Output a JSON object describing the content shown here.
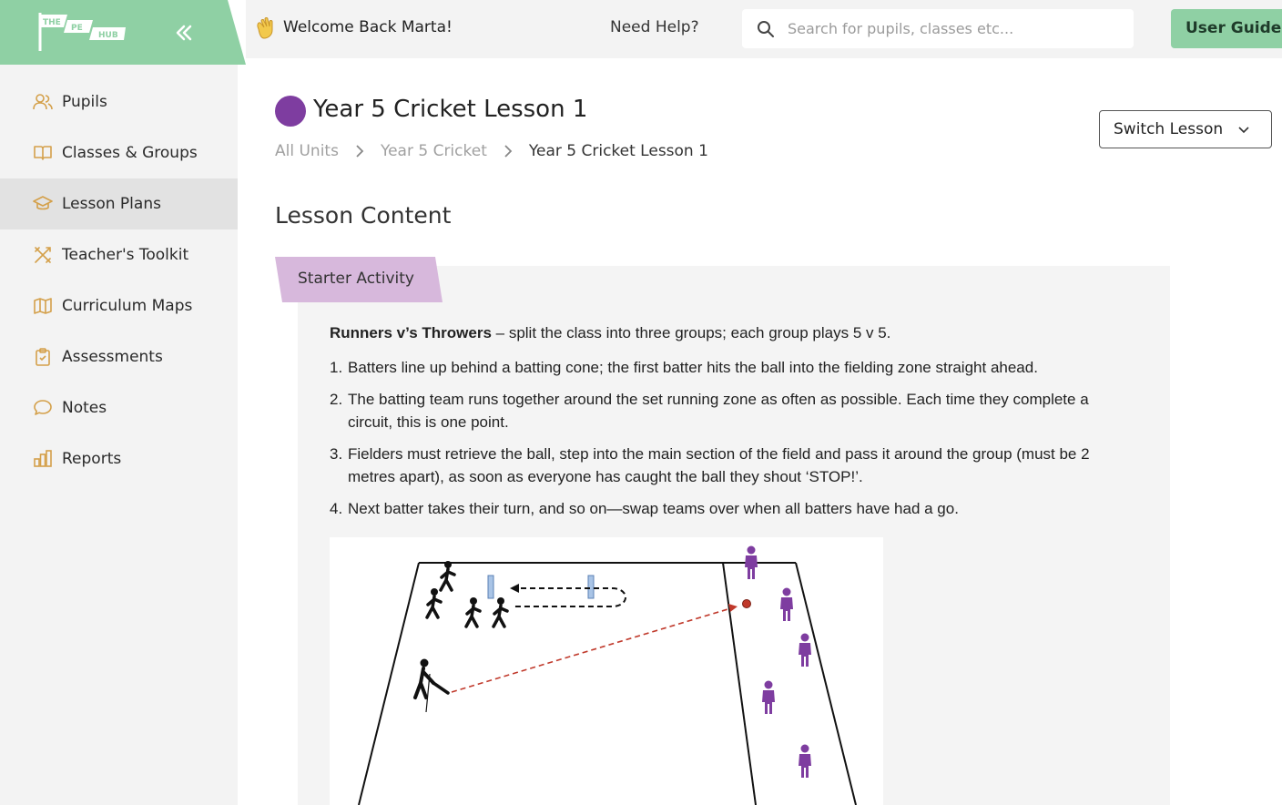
{
  "brand": {
    "logo_words": [
      "THE",
      "PE",
      "HUB"
    ],
    "accent": "#8fd0a4"
  },
  "header": {
    "welcome": "Welcome Back Marta!",
    "need_help": "Need Help?",
    "search_placeholder": "Search for pupils, classes etc...",
    "user_guides": "User Guides"
  },
  "sidebar": {
    "items": [
      {
        "label": "Pupils",
        "icon": "users-icon"
      },
      {
        "label": "Classes & Groups",
        "icon": "book-icon"
      },
      {
        "label": "Lesson Plans",
        "icon": "graduation-cap-icon",
        "active": true
      },
      {
        "label": "Teacher's Toolkit",
        "icon": "tools-icon"
      },
      {
        "label": "Curriculum Maps",
        "icon": "map-icon"
      },
      {
        "label": "Assessments",
        "icon": "clipboard-icon"
      },
      {
        "label": "Notes",
        "icon": "speech-bubble-icon"
      },
      {
        "label": "Reports",
        "icon": "bar-chart-icon"
      }
    ]
  },
  "page": {
    "title": "Year 5 Cricket Lesson 1",
    "title_dot_color": "#7e3da0",
    "breadcrumb": [
      "All Units",
      "Year 5 Cricket",
      "Year 5 Cricket Lesson 1"
    ],
    "switch_lesson": "Switch Lesson",
    "section_title": "Lesson Content"
  },
  "activity": {
    "tab": "Starter Activity",
    "intro_bold": "Runners v’s Throwers",
    "intro_rest": " – split the class into three groups; each group plays 5 v 5.",
    "steps": [
      {
        "num": "1.",
        "text": "Batters line up behind a batting cone; the first batter hits the ball into the fielding zone straight ahead."
      },
      {
        "num": "2.",
        "text": "The batting team runs together around the set running zone as often as possible. Each time they complete a circuit, this is one point."
      },
      {
        "num": "3.",
        "text": "Fielders must retrieve the ball, step into the main section of the field and pass it around the group (must be 2 metres apart), as soon as everyone has caught the ball they shout ‘STOP!’."
      },
      {
        "num": "4.",
        "text": "Next batter takes their turn, and so on—swap teams over when all batters have had a go."
      }
    ]
  }
}
